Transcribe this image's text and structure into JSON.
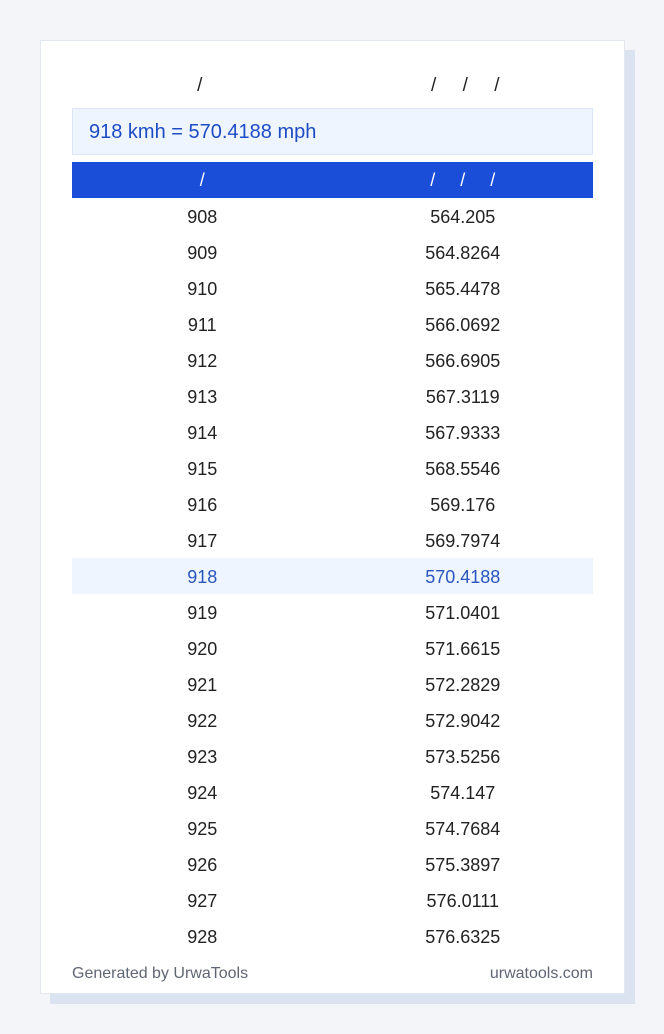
{
  "header": {
    "left_label": "/",
    "right_label": "/     /     /"
  },
  "result": {
    "text": "918 kmh = 570.4188 mph"
  },
  "table": {
    "columns": [
      "/",
      "/     /     /"
    ],
    "rows": [
      {
        "kmh": "908",
        "mph": "564.205"
      },
      {
        "kmh": "909",
        "mph": "564.8264"
      },
      {
        "kmh": "910",
        "mph": "565.4478"
      },
      {
        "kmh": "911",
        "mph": "566.0692"
      },
      {
        "kmh": "912",
        "mph": "566.6905"
      },
      {
        "kmh": "913",
        "mph": "567.3119"
      },
      {
        "kmh": "914",
        "mph": "567.9333"
      },
      {
        "kmh": "915",
        "mph": "568.5546"
      },
      {
        "kmh": "916",
        "mph": "569.176"
      },
      {
        "kmh": "917",
        "mph": "569.7974"
      },
      {
        "kmh": "918",
        "mph": "570.4188"
      },
      {
        "kmh": "919",
        "mph": "571.0401"
      },
      {
        "kmh": "920",
        "mph": "571.6615"
      },
      {
        "kmh": "921",
        "mph": "572.2829"
      },
      {
        "kmh": "922",
        "mph": "572.9042"
      },
      {
        "kmh": "923",
        "mph": "573.5256"
      },
      {
        "kmh": "924",
        "mph": "574.147"
      },
      {
        "kmh": "925",
        "mph": "574.7684"
      },
      {
        "kmh": "926",
        "mph": "575.3897"
      },
      {
        "kmh": "927",
        "mph": "576.0111"
      },
      {
        "kmh": "928",
        "mph": "576.6325"
      }
    ],
    "highlighted_row": 10
  },
  "footer": {
    "left": "Generated by UrwaTools",
    "right": "urwatools.com"
  },
  "colors": {
    "accent": "#1a4ed8",
    "highlight_bg": "#eef5ff",
    "highlight_text": "#2a55bf"
  }
}
